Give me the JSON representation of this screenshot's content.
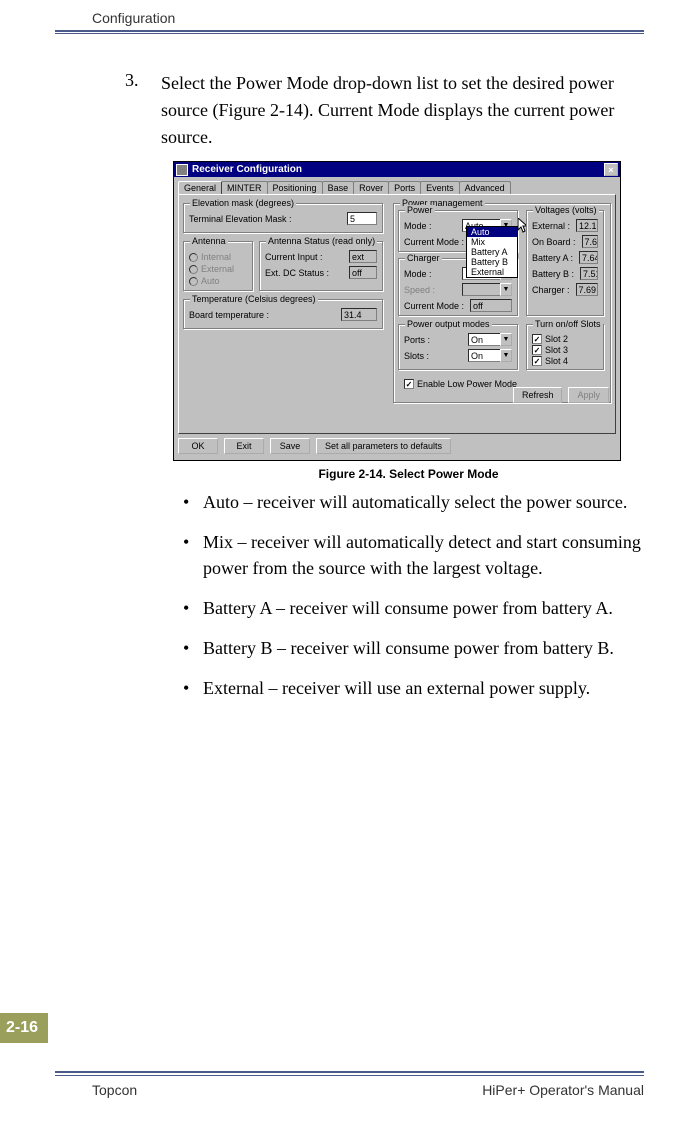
{
  "header": {
    "title": "Configuration"
  },
  "step": {
    "number": "3.",
    "text": "Select the Power Mode drop-down list to set the desired power source (Figure 2-14). Current Mode displays the current power source."
  },
  "figure": {
    "caption": "Figure 2-14. Select Power Mode",
    "window_title": "Receiver Configuration",
    "close": "×",
    "tabs": [
      "General",
      "MINTER",
      "Positioning",
      "Base",
      "Rover",
      "Ports",
      "Events",
      "Advanced"
    ],
    "elevation": {
      "title": "Elevation mask (degrees)",
      "label": "Terminal Elevation Mask :",
      "value": "5"
    },
    "antenna": {
      "title": "Antenna",
      "opts": [
        "Internal",
        "External",
        "Auto"
      ],
      "status_title": "Antenna Status (read only)",
      "current_input_label": "Current Input :",
      "current_input_value": "ext",
      "ext_dc_label": "Ext. DC Status :",
      "ext_dc_value": "off"
    },
    "temperature": {
      "title": "Temperature (Celsius degrees)",
      "label": "Board temperature :",
      "value": "31.4"
    },
    "power_mgmt": {
      "title": "Power management",
      "power_title": "Power",
      "mode_label": "Mode :",
      "mode_value": "Auto",
      "current_mode_label": "Current Mode :",
      "dropdown_options": [
        "Auto",
        "Mix",
        "Battery A",
        "Battery B",
        "External"
      ],
      "charger_title": "Charger",
      "charger_mode_label": "Mode :",
      "speed_label": "Speed :",
      "charger_current_label": "Current Mode :",
      "charger_current_value": "off"
    },
    "voltages": {
      "title": "Voltages (volts)",
      "external_label": "External :",
      "external_value": "12.1",
      "onboard_label": "On Board :",
      "onboard_value": "7.6",
      "batta_label": "Battery A :",
      "batta_value": "7.64",
      "battb_label": "Battery B :",
      "battb_value": "7.51",
      "charger_label": "Charger :",
      "charger_value": "7.69"
    },
    "output_modes": {
      "title": "Power output modes",
      "ports_label": "Ports :",
      "ports_value": "On",
      "slots_label": "Slots :",
      "slots_value": "On"
    },
    "slots": {
      "title": "Turn on/off Slots",
      "items": [
        "Slot 2",
        "Slot 3",
        "Slot 4"
      ]
    },
    "low_power": "Enable Low Power Mode",
    "buttons": {
      "refresh": "Refresh",
      "apply": "Apply",
      "ok": "OK",
      "exit": "Exit",
      "save": "Save",
      "defaults": "Set all parameters to defaults"
    }
  },
  "bullets": [
    "Auto – receiver will automatically select the power source.",
    "Mix – receiver will automatically detect and start consuming power from the source with the largest voltage.",
    "Battery A – receiver will consume power from battery A.",
    "Battery B – receiver will consume power from battery B.",
    "External – receiver will use an external power supply."
  ],
  "page_num": "2-16",
  "footer": {
    "left": "Topcon",
    "right": "HiPer+ Operator's Manual"
  }
}
